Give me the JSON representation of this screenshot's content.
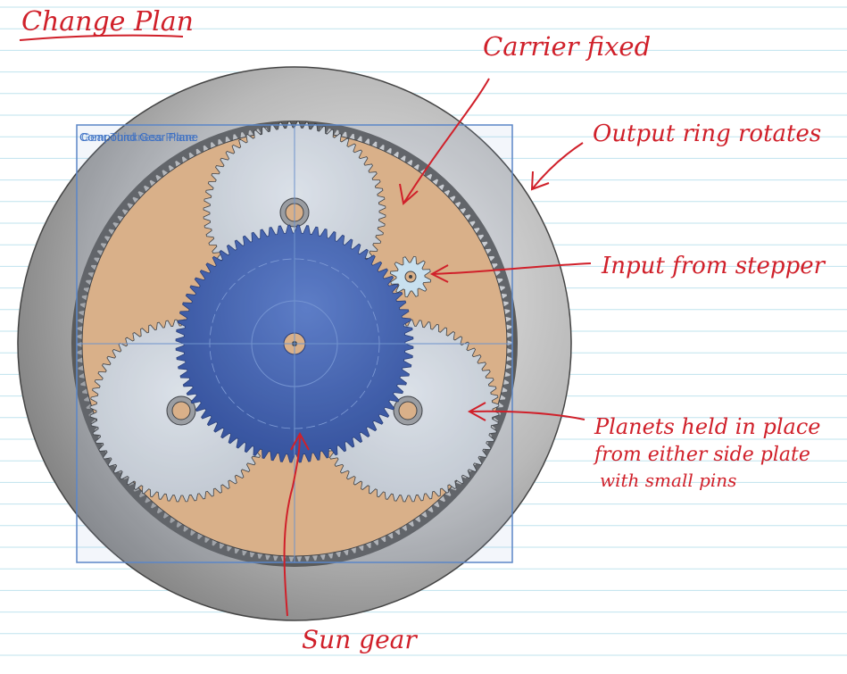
{
  "title": "Change Plan",
  "cad": {
    "overlay_label_1": "Compound Gear Plane",
    "overlay_label_2": "Gear Thickness Plane"
  },
  "annotations": {
    "carrier": "Carrier fixed",
    "ring": "Output ring rotates",
    "input": "Input from stepper",
    "planets_line1": "Planets held in place",
    "planets_line2": "from either side plate",
    "planets_line3": "with small pins",
    "sun": "Sun gear"
  },
  "colors": {
    "ink": "#d0202a",
    "ruling": "#bfe3ee",
    "housing": "#8e8e8e",
    "carrier": "#e2b07e",
    "sun": "#2d55a8",
    "planet": "#d4d8dd",
    "cad_frame": "#5b86c7"
  }
}
